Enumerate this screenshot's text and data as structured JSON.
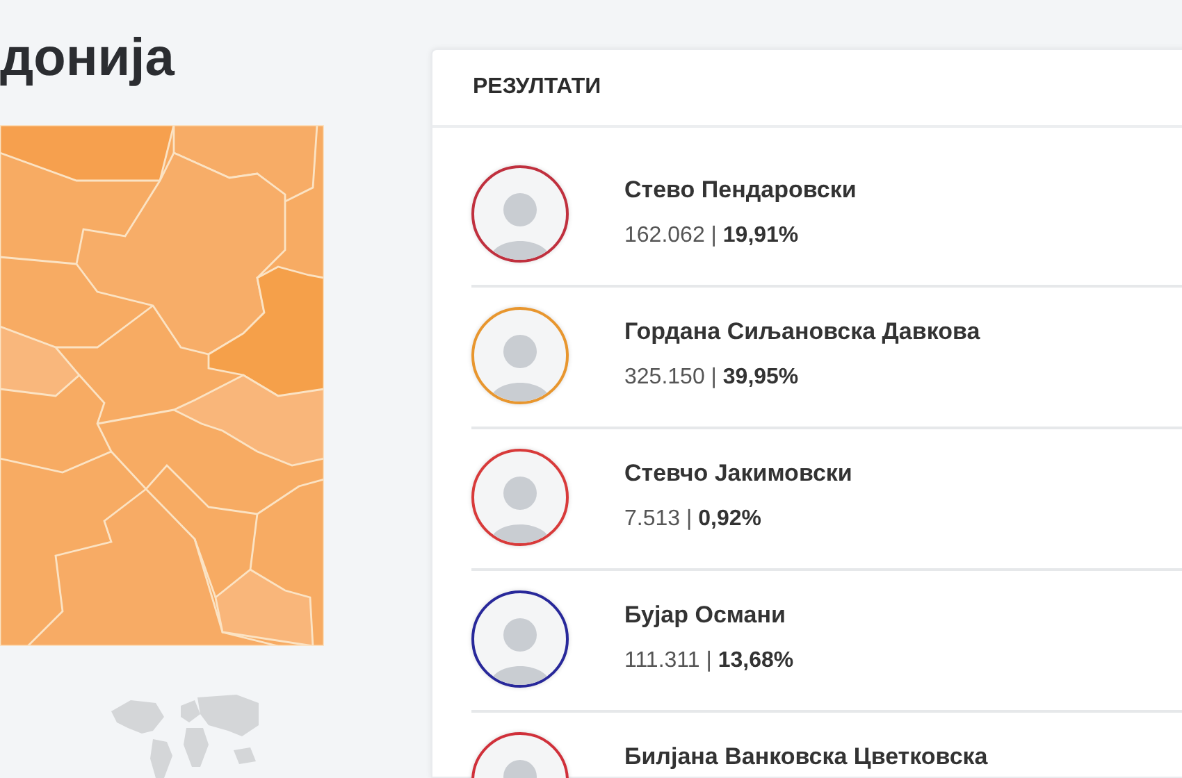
{
  "page_heading": "донија",
  "results": {
    "title": "РЕЗУЛТАТИ",
    "candidates": [
      {
        "name": "Стево Пендаровски",
        "stats": "162.062 | **19,91%**",
        "color": "#c0303e"
      },
      {
        "name": "Гордана Сиљановска Давкова",
        "stats": "325.150 | **39,95%**",
        "color": "#e8962e"
      },
      {
        "name": "Стевчо Јакимовски",
        "stats": "7.513 | **0,92%**",
        "color": "#d83a3a"
      },
      {
        "name": "Бујар Османи",
        "stats": "111.311 | **13,68%**",
        "color": "#28289a"
      },
      {
        "name": "Билјана Ванковска Цветковска",
        "color": "#d0303a"
      }
    ]
  }
}
